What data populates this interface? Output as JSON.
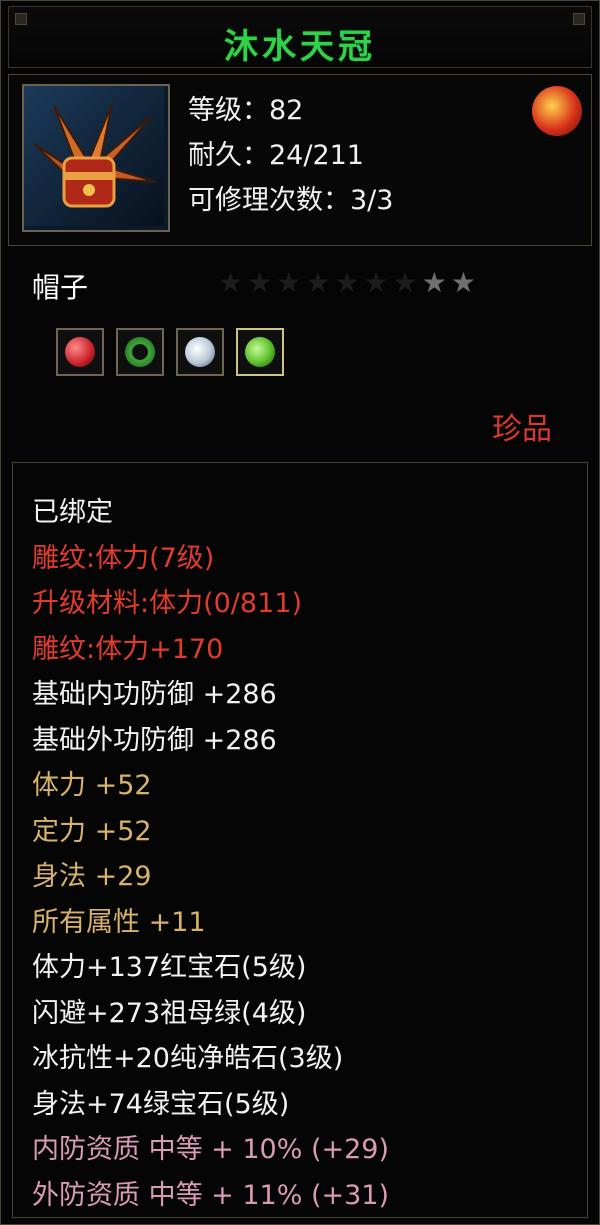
{
  "item": {
    "name": "沐水天冠",
    "icon": "hat-crown-icon",
    "level_line": "等级：82",
    "durability_line": "耐久：24/211",
    "repair_line": "可修理次数：3/3",
    "badge_icon": "fire-orb-icon",
    "type": "帽子",
    "stars": {
      "filled": 2,
      "total": 9
    },
    "quality": "珍品"
  },
  "gem_slots": [
    {
      "icon": "ruby-gem-icon",
      "color": "#c8202a"
    },
    {
      "icon": "jade-ring-icon",
      "color": "#3fa83a"
    },
    {
      "icon": "diamond-gem-icon",
      "color": "#b8c7d6"
    },
    {
      "icon": "emerald-gem-icon",
      "color": "#5bbf2a"
    }
  ],
  "attributes": {
    "bound": "已绑定",
    "engrave": "雕纹:体力(7级)",
    "upgrade_material": "升级材料:体力(0/811)",
    "engrave_bonus": "雕纹:体力+170",
    "base_inner_def": "基础内功防御 +286",
    "base_outer_def": "基础外功防御 +286",
    "stamina": "体力 +52",
    "focus": "定力 +52",
    "agility": "身法 +29",
    "all_attr": "所有属性 +11",
    "gem_1": "体力+137红宝石(5级)",
    "gem_2": "闪避+273祖母绿(4级)",
    "gem_3": "冰抗性+20纯净皓石(3级)",
    "gem_4": "身法+74绿宝石(5级)",
    "inner_quality": "内防资质 中等 + 10% (+29)",
    "outer_quality": "外防资质 中等 + 11% (+31)"
  },
  "colors": {
    "title": "#2fd34a",
    "red": "#e03c2e",
    "gold": "#d7b26b",
    "pink": "#d89ab5"
  }
}
